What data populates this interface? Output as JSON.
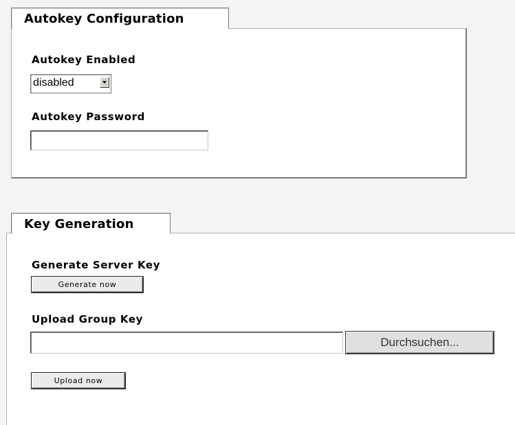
{
  "autokey": {
    "tab_title": "Autokey Configuration",
    "enabled_label": "Autokey Enabled",
    "enabled_value": "disabled",
    "password_label": "Autokey Password",
    "password_value": ""
  },
  "keygen": {
    "tab_title": "Key Generation",
    "generate_label": "Generate Server Key",
    "generate_button": "Generate now",
    "upload_label": "Upload Group Key",
    "upload_value": "",
    "browse_button": "Durchsuchen...",
    "upload_button": "Upload now"
  }
}
